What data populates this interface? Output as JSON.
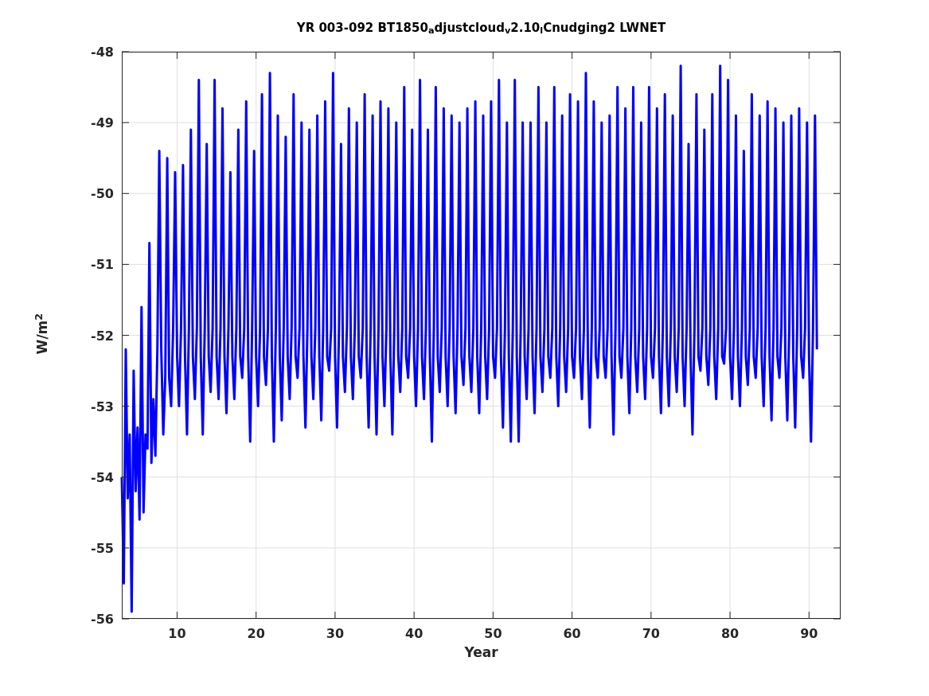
{
  "figure": {
    "chart_data": {
      "type": "line",
      "title": "YR 003-092 BT1850$_{a}$djustcloud$_{v}$2.10$_{l}$Cnudging2 LWNET",
      "xlabel": "Year",
      "ylabel": "W/m$^{2}$",
      "xlim": [
        3,
        94
      ],
      "ylim": [
        -56,
        -48
      ],
      "grid": true,
      "xticks": [
        10,
        20,
        30,
        40,
        50,
        60,
        70,
        80,
        90
      ],
      "yticks": [
        -56,
        -55,
        -54,
        -53,
        -52,
        -51,
        -50,
        -49,
        -48
      ],
      "x": [
        3,
        3.25,
        3.5,
        3.75,
        4,
        4.25,
        4.5,
        4.75,
        5,
        5.25,
        5.5,
        5.75,
        6,
        6.25,
        6.5,
        6.75,
        7,
        7.25,
        7.5,
        7.75,
        8,
        8.25,
        8.5,
        8.75,
        9,
        9.25,
        9.5,
        9.75,
        10,
        10.25,
        10.5,
        10.75,
        11,
        11.25,
        11.5,
        11.75,
        12,
        12.25,
        12.5,
        12.75,
        13,
        13.25,
        13.5,
        13.75,
        14,
        14.25,
        14.5,
        14.75,
        15,
        15.25,
        15.5,
        15.75,
        16,
        16.25,
        16.5,
        16.75,
        17,
        17.25,
        17.5,
        17.75,
        18,
        18.25,
        18.5,
        18.75,
        19,
        19.25,
        19.5,
        19.75,
        20,
        20.25,
        20.5,
        20.75,
        21,
        21.25,
        21.5,
        21.75,
        22,
        22.25,
        22.5,
        22.75,
        23,
        23.25,
        23.5,
        23.75,
        24,
        24.25,
        24.5,
        24.75,
        25,
        25.25,
        25.5,
        25.75,
        26,
        26.25,
        26.5,
        26.75,
        27,
        27.25,
        27.5,
        27.75,
        28,
        28.25,
        28.5,
        28.75,
        29,
        29.25,
        29.5,
        29.75,
        30,
        30.25,
        30.5,
        30.75,
        31,
        31.25,
        31.5,
        31.75,
        32,
        32.25,
        32.5,
        32.75,
        33,
        33.25,
        33.5,
        33.75,
        34,
        34.25,
        34.5,
        34.75,
        35,
        35.25,
        35.5,
        35.75,
        36,
        36.25,
        36.5,
        36.75,
        37,
        37.25,
        37.5,
        37.75,
        38,
        38.25,
        38.5,
        38.75,
        39,
        39.25,
        39.5,
        39.75,
        40,
        40.25,
        40.5,
        40.75,
        41,
        41.25,
        41.5,
        41.75,
        42,
        42.25,
        42.5,
        42.75,
        43,
        43.25,
        43.5,
        43.75,
        44,
        44.25,
        44.5,
        44.75,
        45,
        45.25,
        45.5,
        45.75,
        46,
        46.25,
        46.5,
        46.75,
        47,
        47.25,
        47.5,
        47.75,
        48,
        48.25,
        48.5,
        48.75,
        49,
        49.25,
        49.5,
        49.75,
        50,
        50.25,
        50.5,
        50.75,
        51,
        51.25,
        51.5,
        51.75,
        52,
        52.25,
        52.5,
        52.75,
        53,
        53.25,
        53.5,
        53.75,
        54,
        54.25,
        54.5,
        54.75,
        55,
        55.25,
        55.5,
        55.75,
        56,
        56.25,
        56.5,
        56.75,
        57,
        57.25,
        57.5,
        57.75,
        58,
        58.25,
        58.5,
        58.75,
        59,
        59.25,
        59.5,
        59.75,
        60,
        60.25,
        60.5,
        60.75,
        61,
        61.25,
        61.5,
        61.75,
        62,
        62.25,
        62.5,
        62.75,
        63,
        63.25,
        63.5,
        63.75,
        64,
        64.25,
        64.5,
        64.75,
        65,
        65.25,
        65.5,
        65.75,
        66,
        66.25,
        66.5,
        66.75,
        67,
        67.25,
        67.5,
        67.75,
        68,
        68.25,
        68.5,
        68.75,
        69,
        69.25,
        69.5,
        69.75,
        70,
        70.25,
        70.5,
        70.75,
        71,
        71.25,
        71.5,
        71.75,
        72,
        72.25,
        72.5,
        72.75,
        73,
        73.25,
        73.5,
        73.75,
        74,
        74.25,
        74.5,
        74.75,
        75,
        75.25,
        75.5,
        75.75,
        76,
        76.25,
        76.5,
        76.75,
        77,
        77.25,
        77.5,
        77.75,
        78,
        78.25,
        78.5,
        78.75,
        79,
        79.25,
        79.5,
        79.75,
        80,
        80.25,
        80.5,
        80.75,
        81,
        81.25,
        81.5,
        81.75,
        82,
        82.25,
        82.5,
        82.75,
        83,
        83.25,
        83.5,
        83.75,
        84,
        84.25,
        84.5,
        84.75,
        85,
        85.25,
        85.5,
        85.75,
        86,
        86.25,
        86.5,
        86.75,
        87,
        87.25,
        87.5,
        87.75,
        88,
        88.25,
        88.5,
        88.75,
        89,
        89.25,
        89.5,
        89.75,
        90,
        90.25,
        90.5,
        90.75,
        91
      ],
      "series": [
        {
          "color": "#0000ff",
          "values": [
            -54.0,
            -55.5,
            -52.2,
            -54.3,
            -53.4,
            -55.9,
            -52.5,
            -54.2,
            -53.3,
            -54.6,
            -51.6,
            -54.5,
            -53.4,
            -53.6,
            -50.7,
            -53.8,
            -52.9,
            -53.7,
            -52.2,
            -49.4,
            -52.2,
            -53.4,
            -52.6,
            -49.5,
            -52.6,
            -53.0,
            -51.9,
            -49.7,
            -52.3,
            -53.0,
            -51.9,
            -49.6,
            -52.3,
            -53.4,
            -51.9,
            -49.1,
            -52.3,
            -52.9,
            -51.9,
            -48.4,
            -52.3,
            -53.4,
            -51.9,
            -49.3,
            -52.3,
            -52.8,
            -51.9,
            -48.4,
            -52.3,
            -52.9,
            -51.9,
            -48.8,
            -52.3,
            -53.1,
            -51.9,
            -49.7,
            -52.3,
            -52.9,
            -51.9,
            -49.1,
            -52.3,
            -52.6,
            -51.9,
            -48.7,
            -52.3,
            -53.5,
            -51.9,
            -49.4,
            -52.3,
            -53.0,
            -51.9,
            -48.6,
            -52.3,
            -52.7,
            -51.9,
            -48.3,
            -52.3,
            -53.5,
            -51.9,
            -48.9,
            -52.3,
            -53.2,
            -51.9,
            -49.2,
            -52.3,
            -52.9,
            -51.9,
            -48.6,
            -52.3,
            -52.6,
            -51.9,
            -49.0,
            -52.3,
            -53.3,
            -51.9,
            -49.1,
            -52.3,
            -52.9,
            -51.9,
            -48.9,
            -52.3,
            -53.2,
            -51.9,
            -48.7,
            -52.3,
            -52.5,
            -51.9,
            -48.3,
            -52.3,
            -53.3,
            -51.9,
            -49.3,
            -52.3,
            -52.8,
            -51.9,
            -48.8,
            -52.3,
            -52.9,
            -51.9,
            -49.0,
            -52.3,
            -52.6,
            -51.9,
            -48.6,
            -52.3,
            -53.3,
            -51.9,
            -48.9,
            -52.3,
            -53.4,
            -51.9,
            -48.7,
            -52.3,
            -53.0,
            -51.9,
            -48.8,
            -52.3,
            -53.4,
            -51.9,
            -49.0,
            -52.3,
            -52.8,
            -51.9,
            -48.5,
            -52.3,
            -52.6,
            -51.9,
            -49.1,
            -52.3,
            -53.0,
            -51.9,
            -48.4,
            -52.3,
            -52.9,
            -51.9,
            -49.1,
            -52.3,
            -53.5,
            -51.9,
            -48.5,
            -52.3,
            -52.8,
            -51.9,
            -48.8,
            -52.3,
            -53.0,
            -51.9,
            -48.9,
            -52.3,
            -53.1,
            -51.9,
            -49.0,
            -52.3,
            -52.7,
            -51.9,
            -48.8,
            -52.3,
            -52.8,
            -51.9,
            -48.7,
            -52.3,
            -53.1,
            -51.9,
            -48.9,
            -52.3,
            -52.9,
            -51.9,
            -48.7,
            -52.3,
            -52.6,
            -51.9,
            -48.4,
            -52.3,
            -53.3,
            -51.9,
            -49.0,
            -52.3,
            -53.5,
            -51.9,
            -48.4,
            -52.3,
            -53.5,
            -51.9,
            -49.0,
            -52.3,
            -52.9,
            -51.9,
            -49.0,
            -52.3,
            -53.1,
            -51.9,
            -48.5,
            -52.3,
            -52.8,
            -51.9,
            -49.0,
            -52.3,
            -52.6,
            -51.9,
            -48.5,
            -52.3,
            -53.0,
            -51.9,
            -48.9,
            -52.3,
            -52.8,
            -51.9,
            -48.6,
            -52.3,
            -52.6,
            -51.9,
            -48.7,
            -52.3,
            -52.9,
            -51.9,
            -48.3,
            -52.3,
            -53.3,
            -51.9,
            -48.7,
            -52.3,
            -52.6,
            -51.9,
            -49.0,
            -52.3,
            -52.6,
            -51.9,
            -48.9,
            -52.3,
            -53.4,
            -51.9,
            -48.5,
            -52.3,
            -52.6,
            -51.9,
            -48.8,
            -52.3,
            -53.1,
            -51.9,
            -48.5,
            -52.3,
            -52.8,
            -51.9,
            -49.0,
            -52.3,
            -52.9,
            -51.9,
            -48.5,
            -52.3,
            -52.6,
            -51.9,
            -48.8,
            -52.3,
            -53.1,
            -51.9,
            -48.6,
            -52.3,
            -53.0,
            -51.9,
            -48.9,
            -52.3,
            -52.8,
            -51.9,
            -48.2,
            -52.3,
            -53.0,
            -51.9,
            -49.3,
            -52.3,
            -53.4,
            -51.9,
            -48.6,
            -52.3,
            -52.5,
            -51.9,
            -49.1,
            -52.3,
            -52.7,
            -51.9,
            -48.6,
            -52.3,
            -52.9,
            -51.9,
            -48.2,
            -52.3,
            -52.4,
            -51.9,
            -48.4,
            -52.3,
            -52.9,
            -51.9,
            -48.9,
            -52.3,
            -53.0,
            -51.9,
            -49.4,
            -52.3,
            -52.7,
            -51.9,
            -48.6,
            -52.3,
            -52.6,
            -51.9,
            -48.9,
            -52.3,
            -53.0,
            -51.9,
            -48.7,
            -52.3,
            -53.2,
            -51.9,
            -48.8,
            -52.3,
            -52.6,
            -51.9,
            -49.0,
            -52.3,
            -53.2,
            -51.9,
            -48.9,
            -52.3,
            -53.3,
            -51.9,
            -48.8,
            -52.3,
            -52.6,
            -51.9,
            -49.0,
            -52.3,
            -53.5,
            -51.9,
            -48.9,
            -52.2
          ]
        }
      ]
    }
  }
}
